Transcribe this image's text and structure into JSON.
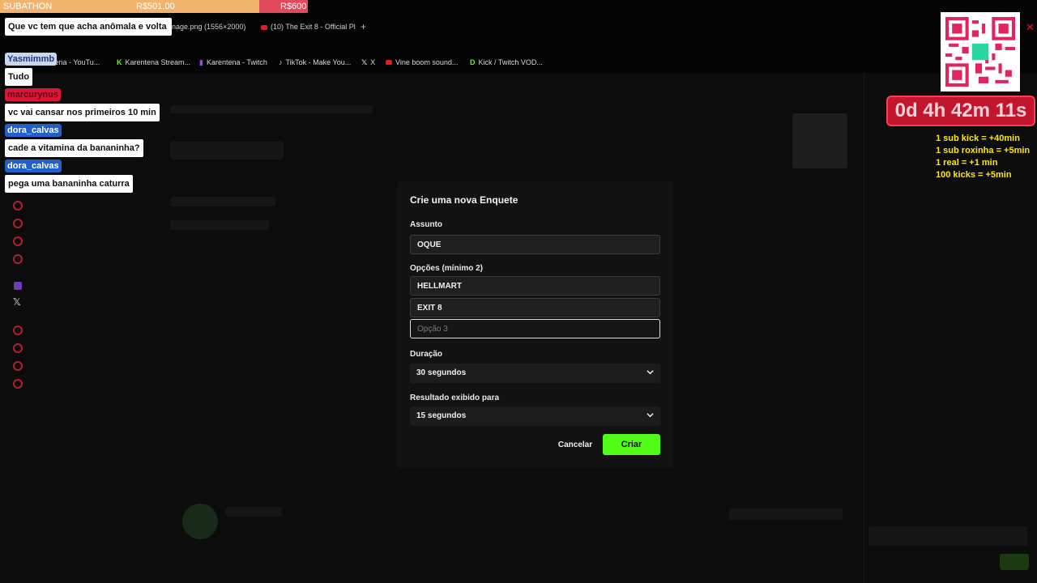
{
  "subathon": {
    "label": "SUBATHON",
    "current": "R$501.00",
    "goal": "R$600",
    "progress": 0.835,
    "fill_color": "#f0b46e",
    "rest_color": "#e04a5c"
  },
  "tabs": [
    {
      "label": "nage.png (1556×2000)"
    },
    {
      "label": "(10) The Exit 8 - Official Pl"
    }
  ],
  "bookmarks": [
    {
      "label": "ntena - YouTu..."
    },
    {
      "label": "Karentena Stream..."
    },
    {
      "label": "Karentena - Twitch"
    },
    {
      "label": "TikTok - Make You..."
    },
    {
      "label": "X"
    },
    {
      "label": "Vine boom sound..."
    },
    {
      "label": "Kick / Twitch VOD..."
    }
  ],
  "chat": [
    {
      "text": "Que vc tem que acha anômala e volta"
    },
    {
      "user": "Yasmimmb",
      "text": "Tudo"
    },
    {
      "user": "marcurynus",
      "text": "vc vai cansar nos primeiros 10 min"
    },
    {
      "user": "dora_calvas",
      "text": "cade a vitamina da bananinha?"
    },
    {
      "user": "dora_calvas",
      "text": "pega uma bananinha caturra"
    }
  ],
  "timer": {
    "value": "0d 4h 42m 11s",
    "color": "#c2162f"
  },
  "rules": [
    "1 sub kick = +40min",
    "1 sub roxinha = +5min",
    "1 real = +1 min",
    "100 kicks = +5min"
  ],
  "modal": {
    "title": "Crie uma nova Enquete",
    "subject_label": "Assunto",
    "subject_value": "OQUE",
    "options_label": "Opções (mínimo 2)",
    "options": [
      "HELLMART",
      "EXIT 8"
    ],
    "option3_placeholder": "Opção 3",
    "duration_label": "Duração",
    "duration_value": "30 segundos",
    "result_label": "Resultado exibido para",
    "result_value": "15 segundos",
    "cancel_label": "Cancelar",
    "create_label": "Criar",
    "accent": "#53fc18"
  }
}
